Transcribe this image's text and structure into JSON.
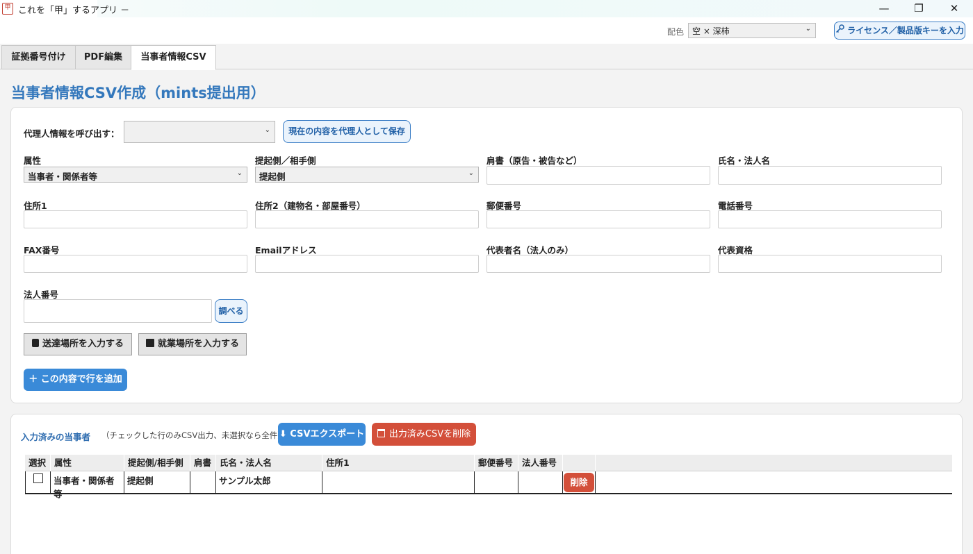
{
  "window": {
    "title": "これを「甲」するアプリ －",
    "icon_text": "甲",
    "minimize": "—",
    "restore": "❐",
    "close": "✕"
  },
  "toolbar": {
    "color_label": "配色",
    "color_value": "空 × 深柿",
    "license_button": "ライセンス／製品版キーを入力"
  },
  "tabs": [
    {
      "label": "証拠番号付け"
    },
    {
      "label": "PDF編集"
    },
    {
      "label": "当事者情報CSV",
      "active": true
    }
  ],
  "page_title": "当事者情報CSV作成（mints提出用）",
  "form": {
    "agent_label": "代理人情報を呼び出す：",
    "agent_value": "",
    "save_agent_button": "現在の内容を代理人として保存",
    "attribute_label": "属性",
    "attribute_value": "当事者・関係者等",
    "side_label": "提起側／相手側",
    "side_value": "提起側",
    "title_label": "肩書（原告・被告など）",
    "name_label": "氏名・法人名",
    "address1_label": "住所1",
    "address2_label": "住所2（建物名・部屋番号）",
    "postal_label": "郵便番号",
    "phone_label": "電話番号",
    "fax_label": "FAX番号",
    "email_label": "Emailアドレス",
    "rep_name_label": "代表者名（法人のみ）",
    "rep_title_label": "代表資格",
    "corp_number_label": "法人番号",
    "lookup_button": "調べる",
    "delivery_button": "送達場所を入力する",
    "workplace_button": "就業場所を入力する",
    "add_row_button": "＋ この内容で行を追加"
  },
  "list": {
    "heading": "入力済みの当事者",
    "hint": "（チェックした行のみCSV出力、未選択なら全件）",
    "export_button": "⬇ CSVエクスポート",
    "delete_exported_button": "出力済みCSVを削除",
    "columns": [
      "選択",
      "属性",
      "提起側/相手側",
      "肩書",
      "氏名・法人名",
      "住所1",
      "郵便番号",
      "法人番号",
      ""
    ],
    "rows": [
      {
        "selected": false,
        "attribute": "当事者・関係者等",
        "side": "提起側",
        "title": "",
        "name": "サンプル太郎",
        "address1": "",
        "postal": "",
        "corp_number": "",
        "delete_label": "削除"
      }
    ]
  },
  "colors": {
    "accent_blue": "#3a8ad8",
    "title_blue": "#3478bc",
    "danger_red": "#d34f3a"
  }
}
